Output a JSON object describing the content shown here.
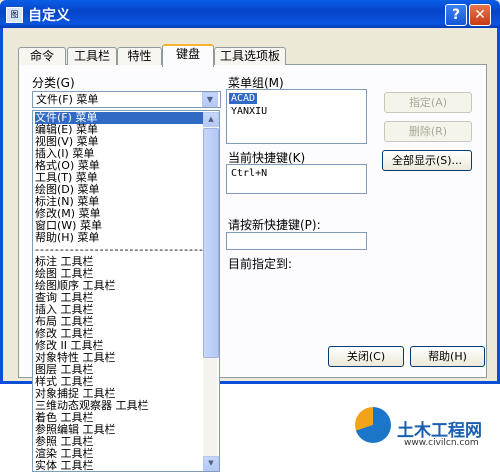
{
  "window": {
    "title": "自定义",
    "icon_text": "图"
  },
  "tabs": [
    "命令",
    "工具栏",
    "特性",
    "键盘",
    "工具选项板"
  ],
  "category": {
    "label": "分类(G)",
    "combo_value": "文件(F) 菜单",
    "items": [
      "文件(F) 菜单",
      "编辑(E) 菜单",
      "视图(V) 菜单",
      "插入(I) 菜单",
      "格式(O) 菜单",
      "工具(T) 菜单",
      "绘图(D) 菜单",
      "标注(N) 菜单",
      "修改(M) 菜单",
      "窗口(W) 菜单",
      "帮助(H) 菜单",
      "--------------------------------------",
      "标注 工具栏",
      "绘图 工具栏",
      "绘图顺序 工具栏",
      "查询 工具栏",
      "插入 工具栏",
      "布局 工具栏",
      "修改 工具栏",
      "修改 II 工具栏",
      "对象特性 工具栏",
      "图层 工具栏",
      "样式 工具栏",
      "对象捕捉 工具栏",
      "三维动态观察器 工具栏",
      "着色 工具栏",
      "参照编辑 工具栏",
      "参照 工具栏",
      "渲染 工具栏",
      "实体 工具栏"
    ]
  },
  "menu_group": {
    "label": "菜单组(M)",
    "items": [
      "ACAD",
      "YANXIU"
    ]
  },
  "buttons": {
    "assign": "指定(A)",
    "delete": "删除(R)",
    "show_all": "全部显示(S)...",
    "close": "关闭(C)",
    "help": "帮助(H)"
  },
  "current_shortcut": {
    "label": "当前快捷键(K)",
    "value": "Ctrl+N"
  },
  "new_shortcut": {
    "label": "请按新快捷键(P):",
    "value": ""
  },
  "assigned_to": {
    "label": "目前指定到:"
  },
  "watermark": {
    "title": "土木工程网",
    "url": "www.civilcn.com"
  }
}
